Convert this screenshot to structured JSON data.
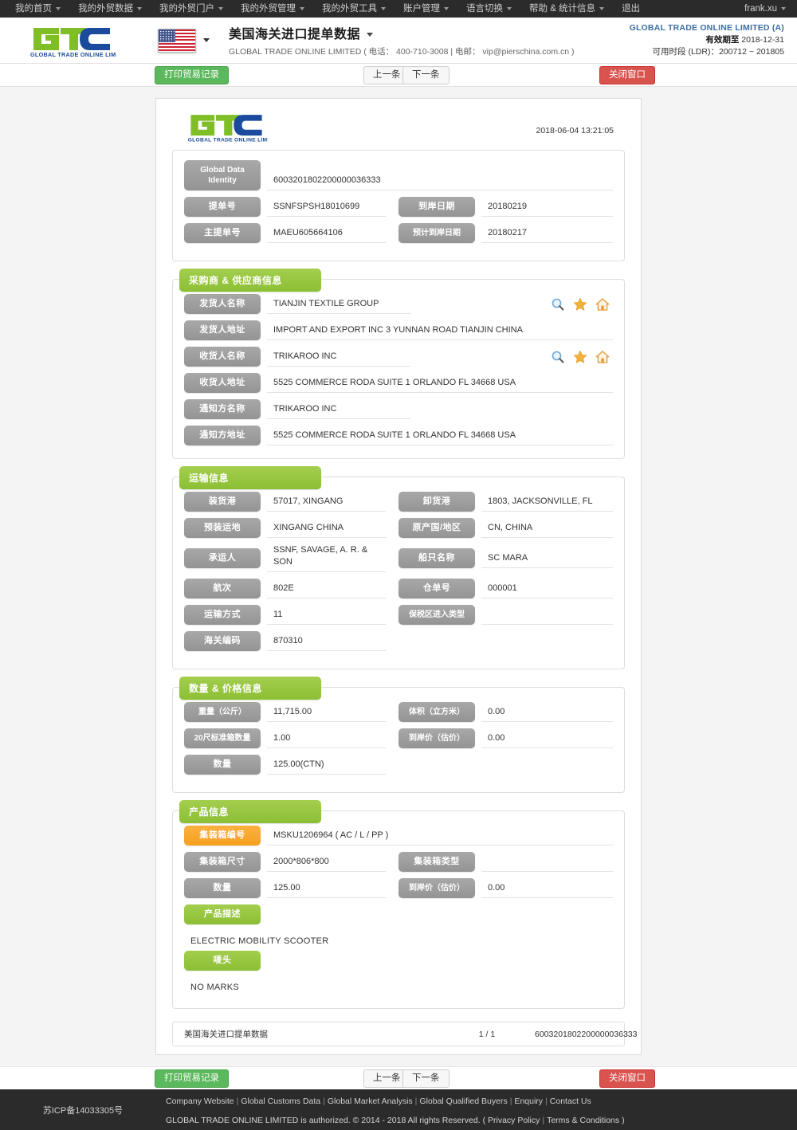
{
  "topnav": {
    "items": [
      {
        "label": "我的首页",
        "caret": true
      },
      {
        "label": "我的外贸数据",
        "caret": true
      },
      {
        "label": "我的外贸门户",
        "caret": true
      },
      {
        "label": "我的外贸管理",
        "caret": true
      },
      {
        "label": "我的外贸工具",
        "caret": true
      },
      {
        "label": "账户管理",
        "caret": true
      },
      {
        "label": "语言切换",
        "caret": true
      },
      {
        "label": "帮助 & 统计信息",
        "caret": true
      },
      {
        "label": "退出",
        "caret": false
      }
    ],
    "user": "frank.xu"
  },
  "header": {
    "logo_text": "GLOBAL TRADE ONLINE LIMITED",
    "flag": "us-flag-icon",
    "title": "美国海关进口提单数据",
    "subtitle": "GLOBAL TRADE ONLINE LIMITED ( 电话： 400-710-3008 | 电邮： vip@pierschina.com.cn )",
    "account_company": "GLOBAL TRADE ONLINE LIMITED (A)",
    "validity_label": "有效期至",
    "validity_value": "2018-12-31",
    "ldr_line": "可用时段 (LDR)：200712 ~ 201805"
  },
  "toolbar": {
    "print_label": "打印贸易记录",
    "prev_label": "上一条",
    "next_label": "下一条",
    "close_label": "关闭窗口"
  },
  "doc": {
    "timestamp": "2018-06-04 13:21:05",
    "identity": {
      "label": "Global Data Identity",
      "value": "6003201802200000036333"
    },
    "top_rows": [
      {
        "label": "提单号",
        "value": "SSNFSPSH18010699",
        "label2": "到岸日期",
        "value2": "20180219"
      },
      {
        "label": "主提单号",
        "value": "MAEU605664106",
        "label2": "预计到岸日期",
        "value2": "20180217"
      }
    ],
    "sections": [
      {
        "title": "采购商 & 供应商信息",
        "rows": [
          {
            "label": "发货人名称",
            "value": "TIANJIN TEXTILE GROUP",
            "actions": true
          },
          {
            "label": "发货人地址",
            "value": "IMPORT AND EXPORT INC 3 YUNNAN ROAD TIANJIN CHINA",
            "actions": false
          },
          {
            "label": "收货人名称",
            "value": "TRIKAROO INC",
            "actions": true
          },
          {
            "label": "收货人地址",
            "value": "5525 COMMERCE RODA SUITE 1 ORLANDO FL 34668 USA",
            "actions": false
          },
          {
            "label": "通知方名称",
            "value": "TRIKAROO INC",
            "actions": false
          },
          {
            "label": "通知方地址",
            "value": "5525 COMMERCE RODA SUITE 1 ORLANDO FL 34668 USA",
            "actions": false
          }
        ]
      },
      {
        "title": "运输信息",
        "pairs": [
          {
            "label": "装货港",
            "value": "57017, XINGANG",
            "label2": "卸货港",
            "value2": "1803, JACKSONVILLE, FL"
          },
          {
            "label": "预装运地",
            "value": "XINGANG CHINA",
            "label2": "原产国/地区",
            "value2": "CN, CHINA"
          },
          {
            "label": "承运人",
            "value": "SSNF, SAVAGE, A. R. & SON",
            "label2": "船只名称",
            "value2": "SC MARA"
          },
          {
            "label": "航次",
            "value": "802E",
            "label2": "仓单号",
            "value2": "000001"
          },
          {
            "label": "运输方式",
            "value": "11",
            "label2": "保税区进入类型",
            "value2": ""
          },
          {
            "label": "海关编码",
            "value": "870310",
            "label2": "",
            "value2": ""
          }
        ]
      },
      {
        "title": "数量 & 价格信息",
        "pairs": [
          {
            "label": "重量（公斤）",
            "value": "11,715.00",
            "label2": "体积（立方米）",
            "value2": "0.00"
          },
          {
            "label": "20尺标准箱数量",
            "value": "1.00",
            "label2": "到岸价（估价）",
            "value2": "0.00"
          },
          {
            "label": "数量",
            "value": "125.00(CTN)",
            "label2": "",
            "value2": ""
          }
        ]
      },
      {
        "title": "产品信息",
        "container_no_label": "集装箱编号",
        "container_no_value": "MSKU1206964 ( AC / L / PP )",
        "pairs": [
          {
            "label": "集装箱尺寸",
            "value": "2000*806*800",
            "label2": "集装箱类型",
            "value2": ""
          },
          {
            "label": "数量",
            "value": "125.00",
            "label2": "到岸价（估价）",
            "value2": "0.00"
          }
        ],
        "desc_label": "产品描述",
        "desc_value": "ELECTRIC MOBILITY SCOOTER",
        "marks_label": "唛头",
        "marks_value": "NO MARKS"
      }
    ],
    "footer": {
      "name": "美国海关进口提单数据",
      "page": "1 / 1",
      "identity": "6003201802200000036333"
    }
  },
  "footer": {
    "icp": "苏ICP备14033305号",
    "links": [
      "Company Website",
      "Global Customs Data",
      "Global Market Analysis",
      "Global Qualified Buyers",
      "Enquiry",
      "Contact Us"
    ],
    "copyright": "GLOBAL TRADE ONLINE LIMITED is authorized. © 2014 - 2018 All rights Reserved.  (",
    "privacy": "Privacy Policy",
    "terms": "Terms & Conditions",
    "copyright_end": ")"
  },
  "colors": {
    "green": "#8cbf35",
    "orange": "#f5a11e",
    "gray_label": "#949494",
    "accent_blue": "#3b6ea5",
    "btn_green": "#5cb85c",
    "btn_red": "#d9534f"
  }
}
